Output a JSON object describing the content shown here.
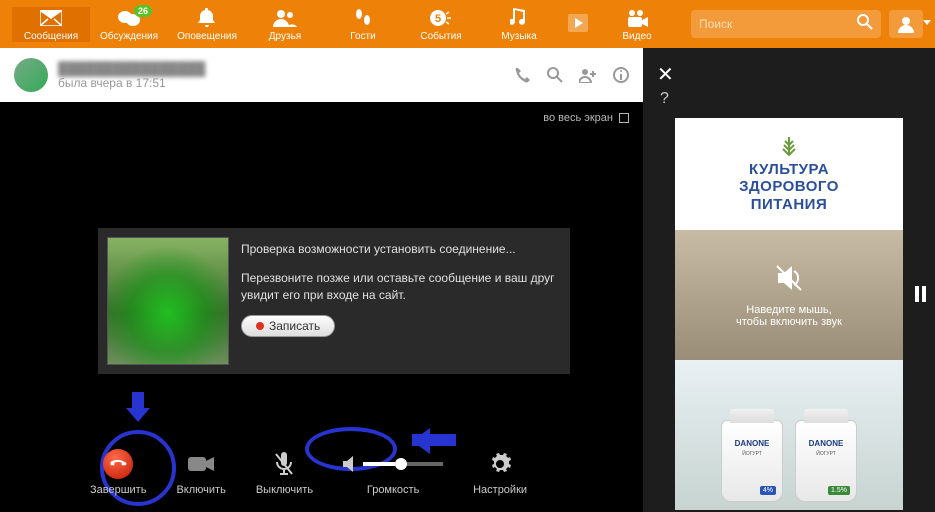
{
  "nav": {
    "messages": "Сообщения",
    "discussions": "Обсуждения",
    "discussions_badge": "26",
    "notifications": "Оповещения",
    "friends": "Друзья",
    "guests": "Гости",
    "events": "События",
    "music": "Музыка",
    "video": "Видео"
  },
  "search": {
    "placeholder": "Поиск"
  },
  "chat": {
    "username": "████████████████",
    "status": "была вчера в 17:51"
  },
  "call": {
    "fullscreen": "во весь экран",
    "checking": "Проверка возможности установить соединение...",
    "callback_msg": "Перезвоните позже или оставьте сообщение и ваш друг увидит его при входе на сайт.",
    "record": "Записать",
    "controls": {
      "end": "Завершить",
      "video_on": "Включить",
      "mute": "Выключить",
      "volume": "Громкость",
      "settings": "Настройки"
    }
  },
  "side": {
    "close": "✕",
    "help": "?"
  },
  "ads": {
    "ad1_line1": "КУЛЬТУРА",
    "ad1_line2": "ЗДОРОВОГО",
    "ad1_line3": "ПИТАНИЯ",
    "ad2_line1": "Наведите мышь,",
    "ad2_line2": "чтобы включить звук",
    "jar_brand": "DANONE",
    "jar_sub": "ЙОГУРТ",
    "jar1_pct": "4%",
    "jar2_pct": "1.5%"
  }
}
